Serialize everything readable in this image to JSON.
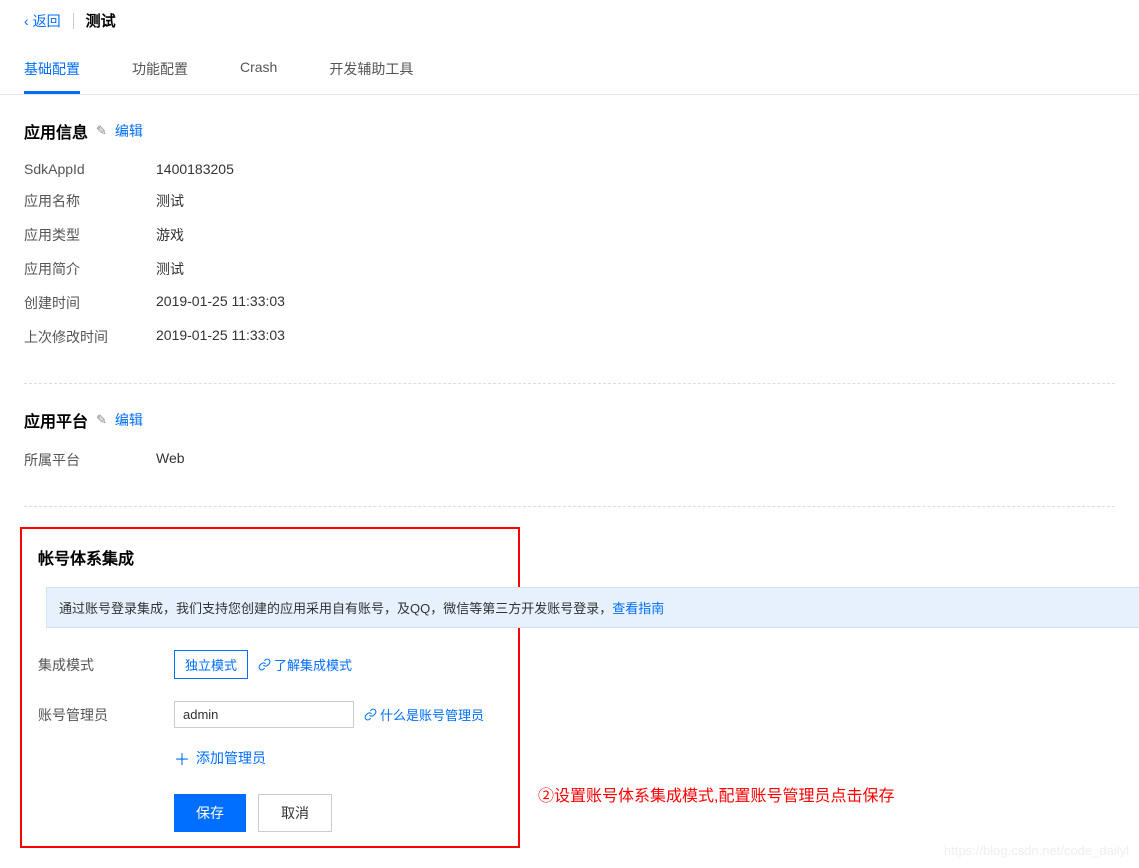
{
  "header": {
    "back_label": "返回",
    "title": "测试"
  },
  "tabs": [
    {
      "label": "基础配置",
      "active": true
    },
    {
      "label": "功能配置",
      "active": false
    },
    {
      "label": "Crash",
      "active": false
    },
    {
      "label": "开发辅助工具",
      "active": false
    }
  ],
  "app_info": {
    "title": "应用信息",
    "edit_label": "编辑",
    "rows": [
      {
        "label": "SdkAppId",
        "value": "1400183205"
      },
      {
        "label": "应用名称",
        "value": "测试"
      },
      {
        "label": "应用类型",
        "value": "游戏"
      },
      {
        "label": "应用简介",
        "value": "测试"
      },
      {
        "label": "创建时间",
        "value": "2019-01-25 11:33:03"
      },
      {
        "label": "上次修改时间",
        "value": "2019-01-25 11:33:03"
      }
    ]
  },
  "platform": {
    "title": "应用平台",
    "edit_label": "编辑",
    "rows": [
      {
        "label": "所属平台",
        "value": "Web"
      }
    ]
  },
  "account": {
    "title": "帐号体系集成",
    "notice_text": "通过账号登录集成，我们支持您创建的应用采用自有账号，及QQ，微信等第三方开发账号登录，",
    "notice_link": "查看指南",
    "mode_label": "集成模式",
    "mode_option": "独立模式",
    "mode_help": "了解集成模式",
    "admin_label": "账号管理员",
    "admin_value": "admin",
    "admin_help": "什么是账号管理员",
    "add_admin": "添加管理员",
    "save_btn": "保存",
    "cancel_btn": "取消"
  },
  "annotation": "②设置账号体系集成模式,配置账号管理员点击保存",
  "watermark": "https://blog.csdn.net/code_dailyl"
}
